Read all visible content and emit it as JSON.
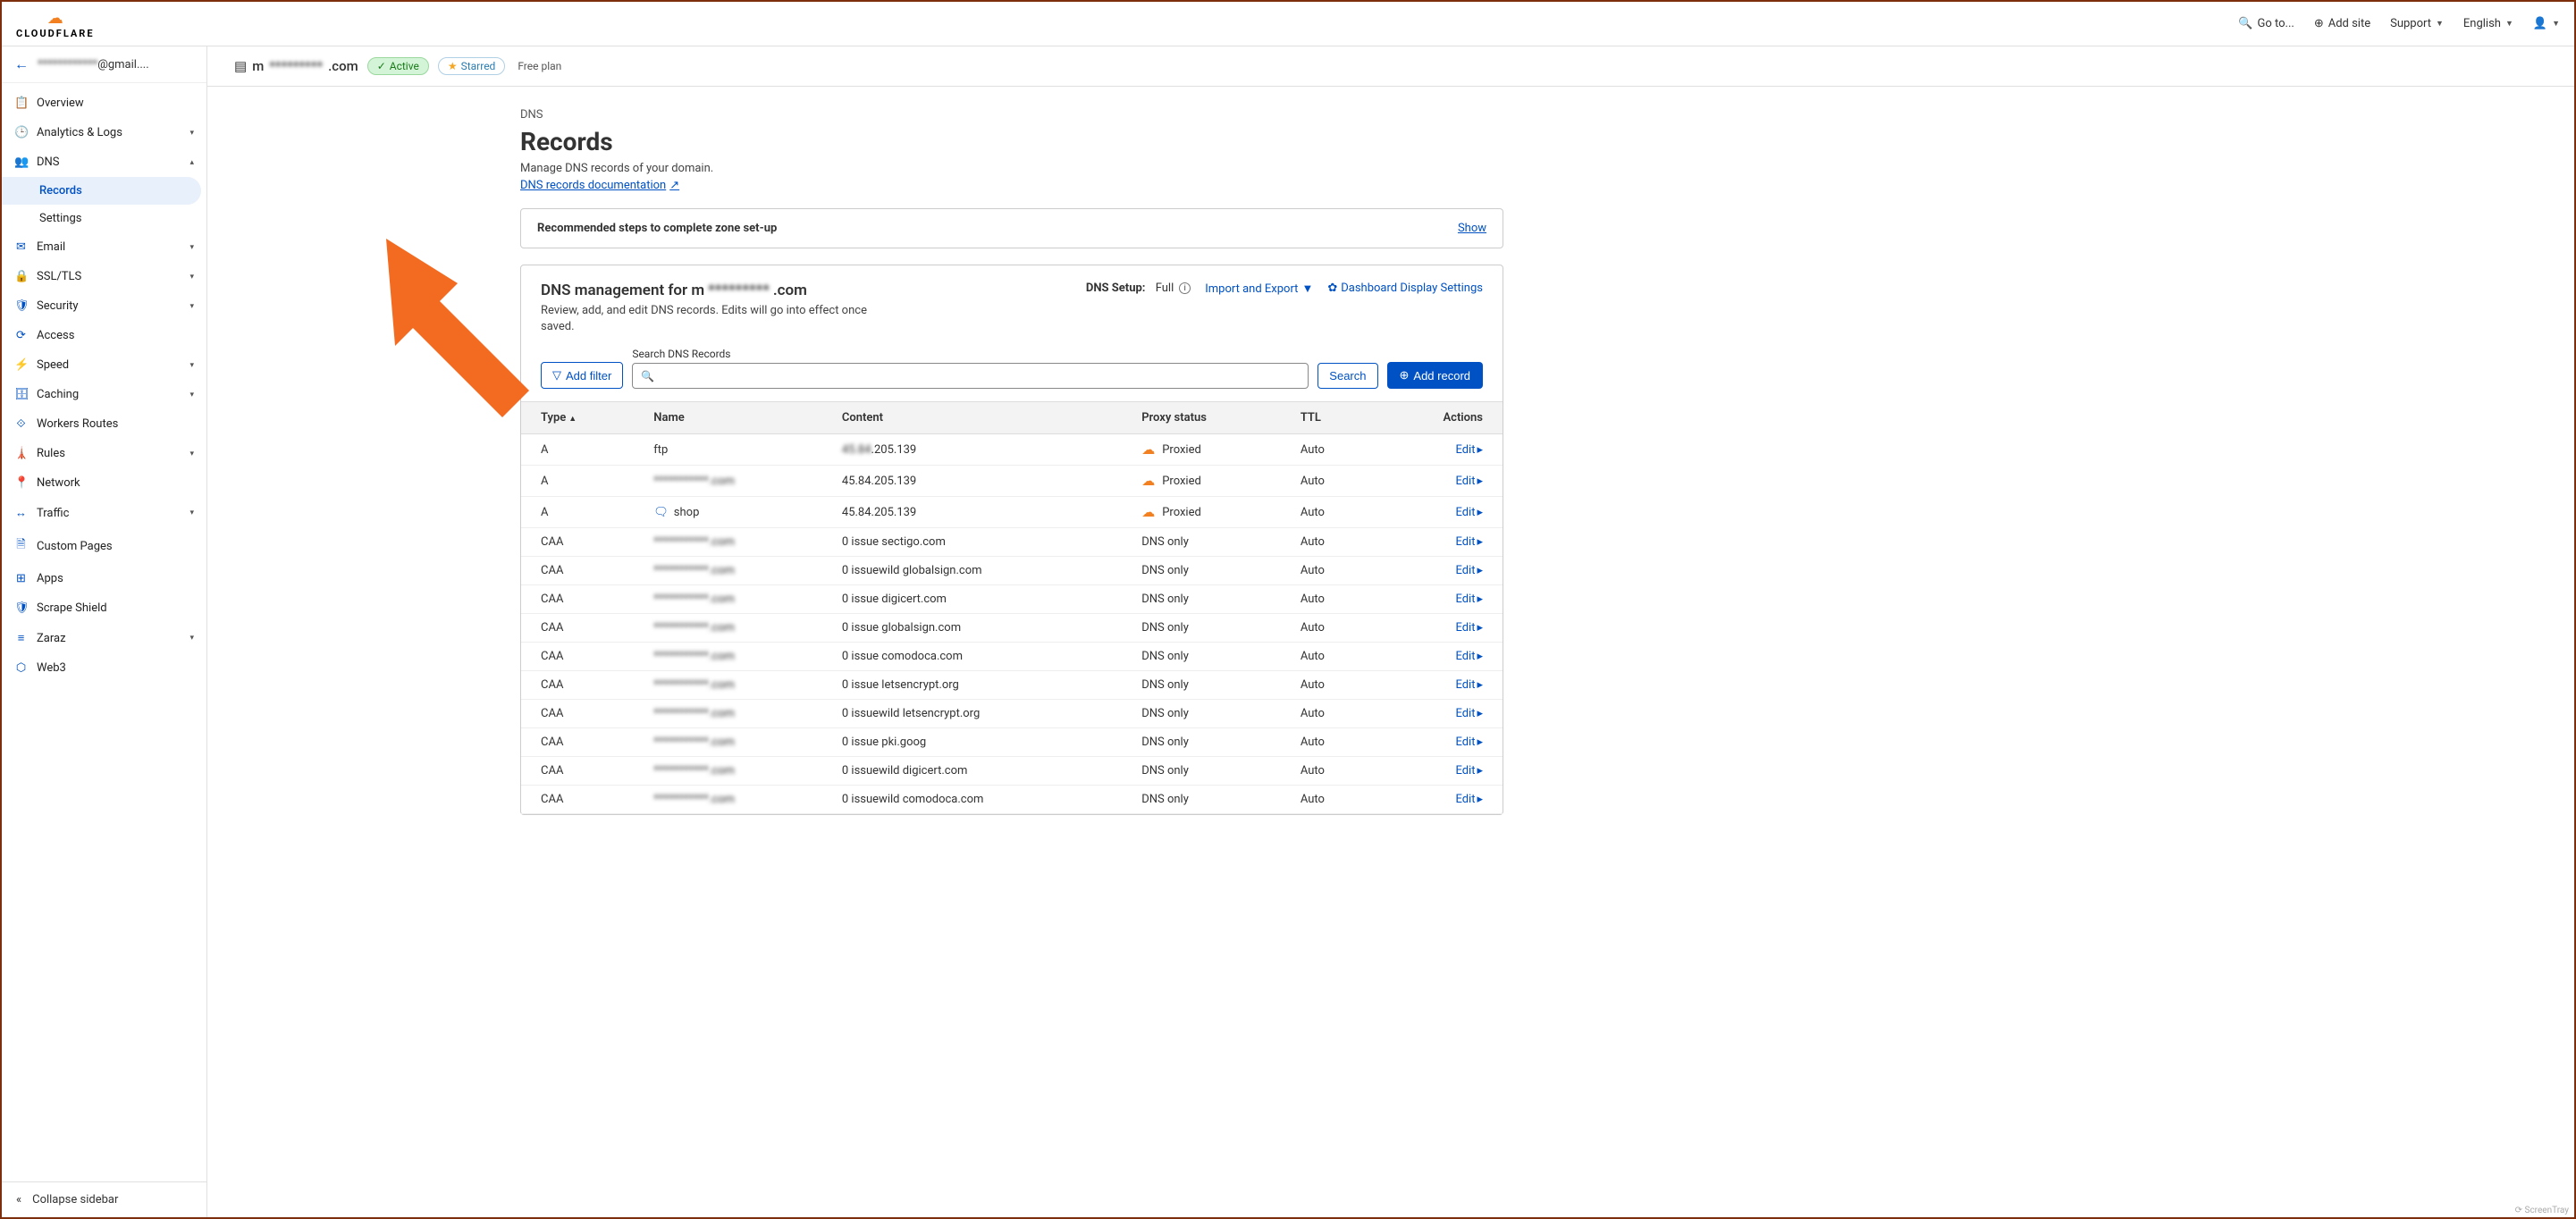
{
  "header": {
    "goto": "Go to...",
    "add_site": "Add site",
    "support": "Support",
    "lang": "English"
  },
  "account": {
    "blur": "************",
    "suffix": "@gmail...."
  },
  "sidebar": {
    "items": [
      {
        "icon": "📋",
        "label": "Overview",
        "chev": ""
      },
      {
        "icon": "🕒",
        "label": "Analytics & Logs",
        "chev": "▾"
      },
      {
        "icon": "👥",
        "label": "DNS",
        "chev": "▴"
      },
      {
        "icon": "✉",
        "label": "Email",
        "chev": "▾"
      },
      {
        "icon": "🔒",
        "label": "SSL/TLS",
        "chev": "▾"
      },
      {
        "icon": "🛡",
        "label": "Security",
        "chev": "▾"
      },
      {
        "icon": "⟳",
        "label": "Access",
        "chev": ""
      },
      {
        "icon": "⚡",
        "label": "Speed",
        "chev": "▾"
      },
      {
        "icon": "🗄",
        "label": "Caching",
        "chev": "▾"
      },
      {
        "icon": "⟐",
        "label": "Workers Routes",
        "chev": ""
      },
      {
        "icon": "🗼",
        "label": "Rules",
        "chev": "▾"
      },
      {
        "icon": "📍",
        "label": "Network",
        "chev": ""
      },
      {
        "icon": "↔",
        "label": "Traffic",
        "chev": "▾"
      },
      {
        "icon": "🗎",
        "label": "Custom Pages",
        "chev": ""
      },
      {
        "icon": "⊞",
        "label": "Apps",
        "chev": ""
      },
      {
        "icon": "🛡",
        "label": "Scrape Shield",
        "chev": ""
      },
      {
        "icon": "≡",
        "label": "Zaraz",
        "chev": "▾"
      },
      {
        "icon": "⬡",
        "label": "Web3",
        "chev": ""
      }
    ],
    "dns_sub": [
      "Records",
      "Settings"
    ],
    "collapse": "Collapse sidebar"
  },
  "domain_bar": {
    "prefix": "m",
    "blur": "*********",
    "suffix": ".com",
    "active": "Active",
    "starred": "Starred",
    "plan": "Free plan"
  },
  "page": {
    "bc": "DNS",
    "title": "Records",
    "desc": "Manage DNS records of your domain.",
    "doc_link": "DNS records documentation",
    "rec_step": "Recommended steps to complete zone set-up",
    "show": "Show"
  },
  "mgmt": {
    "title_pre": "DNS management for m",
    "title_blur": "*********",
    "title_suf": ".com",
    "subtitle": "Review, add, and edit DNS records. Edits will go into effect once saved.",
    "setup_label": "DNS Setup:",
    "setup_val": "Full",
    "import": "Import and Export",
    "display": "Dashboard Display Settings",
    "add_filter": "Add filter",
    "search_label": "Search DNS Records",
    "search_btn": "Search",
    "add_record": "Add record"
  },
  "table": {
    "cols": [
      "Type",
      "Name",
      "Content",
      "Proxy status",
      "TTL",
      "Actions"
    ],
    "edit": "Edit",
    "rows": [
      {
        "type": "A",
        "name": "ftp",
        "name_blur": false,
        "note": false,
        "content": "**.**.205.139",
        "content_blur_prefix": true,
        "proxy": "Proxied",
        "proxy_cloud": true,
        "ttl": "Auto"
      },
      {
        "type": "A",
        "name": "***********.com",
        "name_blur": true,
        "note": false,
        "content": "45.84.205.139",
        "content_blur_prefix": false,
        "proxy": "Proxied",
        "proxy_cloud": true,
        "ttl": "Auto"
      },
      {
        "type": "A",
        "name": "shop",
        "name_blur": false,
        "note": true,
        "content": "45.84.205.139",
        "content_blur_prefix": false,
        "proxy": "Proxied",
        "proxy_cloud": true,
        "ttl": "Auto"
      },
      {
        "type": "CAA",
        "name": "***********.com",
        "name_blur": true,
        "note": false,
        "content": "0 issue sectigo.com",
        "proxy": "DNS only",
        "proxy_cloud": false,
        "ttl": "Auto"
      },
      {
        "type": "CAA",
        "name": "***********.com",
        "name_blur": true,
        "note": false,
        "content": "0 issuewild globalsign.com",
        "proxy": "DNS only",
        "proxy_cloud": false,
        "ttl": "Auto"
      },
      {
        "type": "CAA",
        "name": "***********.com",
        "name_blur": true,
        "note": false,
        "content": "0 issue digicert.com",
        "proxy": "DNS only",
        "proxy_cloud": false,
        "ttl": "Auto"
      },
      {
        "type": "CAA",
        "name": "***********.com",
        "name_blur": true,
        "note": false,
        "content": "0 issue globalsign.com",
        "proxy": "DNS only",
        "proxy_cloud": false,
        "ttl": "Auto"
      },
      {
        "type": "CAA",
        "name": "***********.com",
        "name_blur": true,
        "note": false,
        "content": "0 issue comodoca.com",
        "proxy": "DNS only",
        "proxy_cloud": false,
        "ttl": "Auto"
      },
      {
        "type": "CAA",
        "name": "***********.com",
        "name_blur": true,
        "note": false,
        "content": "0 issue letsencrypt.org",
        "proxy": "DNS only",
        "proxy_cloud": false,
        "ttl": "Auto"
      },
      {
        "type": "CAA",
        "name": "***********.com",
        "name_blur": true,
        "note": false,
        "content": "0 issuewild letsencrypt.org",
        "proxy": "DNS only",
        "proxy_cloud": false,
        "ttl": "Auto"
      },
      {
        "type": "CAA",
        "name": "***********.com",
        "name_blur": true,
        "note": false,
        "content": "0 issue pki.goog",
        "proxy": "DNS only",
        "proxy_cloud": false,
        "ttl": "Auto"
      },
      {
        "type": "CAA",
        "name": "***********.com",
        "name_blur": true,
        "note": false,
        "content": "0 issuewild digicert.com",
        "proxy": "DNS only",
        "proxy_cloud": false,
        "ttl": "Auto"
      },
      {
        "type": "CAA",
        "name": "***********.com",
        "name_blur": true,
        "note": false,
        "content": "0 issuewild comodoca.com",
        "proxy": "DNS only",
        "proxy_cloud": false,
        "ttl": "Auto"
      }
    ]
  },
  "watermark": "⟳ ScreenTray"
}
